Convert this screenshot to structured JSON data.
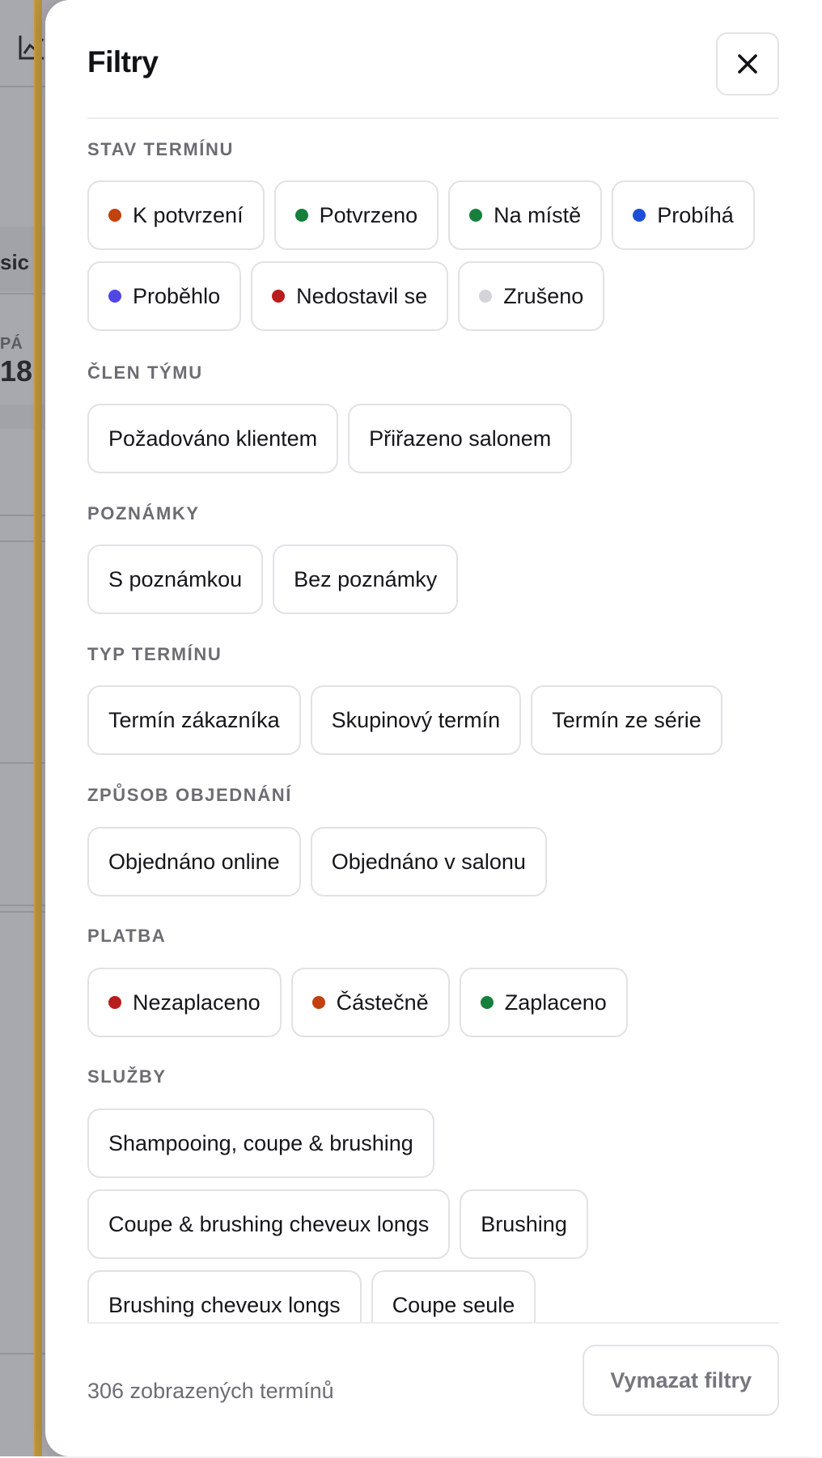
{
  "background": {
    "fragments": [
      "sic",
      "PÁ",
      "18"
    ]
  },
  "drawer": {
    "title": "Filtry",
    "close_icon": "close-icon"
  },
  "sections": [
    {
      "title": "STAV TERMÍNU",
      "rows": [
        [
          {
            "label": "K potvrzení",
            "dot": "#c2410c"
          },
          {
            "label": "Potvrzeno",
            "dot": "#15803d"
          },
          {
            "label": "Na místě",
            "dot": "#15803d"
          },
          {
            "label": "Probíhá",
            "dot": "#1d4ed8"
          }
        ],
        [
          {
            "label": "Proběhlo",
            "dot": "#4f46e5"
          },
          {
            "label": "Nedostavil se",
            "dot": "#b91c1c"
          },
          {
            "label": "Zrušeno",
            "dot": "#d4d4d8"
          }
        ]
      ]
    },
    {
      "title": "ČLEN TÝMU",
      "rows": [
        [
          {
            "label": "Požadováno klientem"
          },
          {
            "label": "Přiřazeno salonem"
          }
        ]
      ]
    },
    {
      "title": "POZNÁMKY",
      "rows": [
        [
          {
            "label": "S poznámkou"
          },
          {
            "label": "Bez poznámky"
          }
        ]
      ]
    },
    {
      "title": "TYP TERMÍNU",
      "rows": [
        [
          {
            "label": "Termín zákazníka"
          },
          {
            "label": "Skupinový termín"
          },
          {
            "label": "Termín ze série"
          }
        ]
      ]
    },
    {
      "title": "ZPŮSOB OBJEDNÁNÍ",
      "rows": [
        [
          {
            "label": "Objednáno online"
          },
          {
            "label": "Objednáno v salonu"
          }
        ]
      ]
    },
    {
      "title": "PLATBA",
      "rows": [
        [
          {
            "label": "Nezaplaceno",
            "dot": "#b91c1c"
          },
          {
            "label": "Částečně",
            "dot": "#c2410c"
          },
          {
            "label": "Zaplaceno",
            "dot": "#15803d"
          }
        ]
      ]
    },
    {
      "title": "SLUŽBY",
      "rows": [
        [
          {
            "label": "Shampooing, coupe & brushing"
          }
        ],
        [
          {
            "label": "Coupe & brushing cheveux longs"
          },
          {
            "label": "Brushing"
          }
        ],
        [
          {
            "label": "Brushing cheveux longs"
          },
          {
            "label": "Coupe seule"
          }
        ]
      ]
    }
  ],
  "footer": {
    "count_text": "306 zobrazených termínů",
    "clear_label": "Vymazat filtry"
  }
}
